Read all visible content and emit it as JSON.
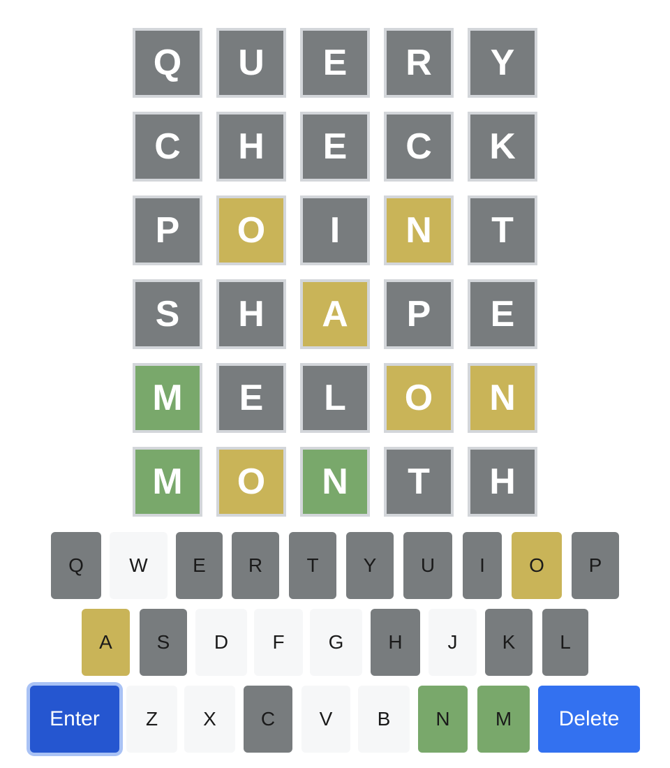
{
  "board": {
    "rows": [
      {
        "letters": [
          "Q",
          "U",
          "E",
          "R",
          "Y"
        ],
        "states": [
          "absent",
          "absent",
          "absent",
          "absent",
          "absent"
        ]
      },
      {
        "letters": [
          "C",
          "H",
          "E",
          "C",
          "K"
        ],
        "states": [
          "absent",
          "absent",
          "absent",
          "absent",
          "absent"
        ]
      },
      {
        "letters": [
          "P",
          "O",
          "I",
          "N",
          "T"
        ],
        "states": [
          "absent",
          "present",
          "absent",
          "present",
          "absent"
        ]
      },
      {
        "letters": [
          "S",
          "H",
          "A",
          "P",
          "E"
        ],
        "states": [
          "absent",
          "absent",
          "present",
          "absent",
          "absent"
        ]
      },
      {
        "letters": [
          "M",
          "E",
          "L",
          "O",
          "N"
        ],
        "states": [
          "correct",
          "absent",
          "absent",
          "present",
          "present"
        ]
      },
      {
        "letters": [
          "M",
          "O",
          "N",
          "T",
          "H"
        ],
        "states": [
          "correct",
          "present",
          "correct",
          "absent",
          "absent"
        ]
      }
    ]
  },
  "keyboard": {
    "rows": [
      [
        {
          "label": "Q",
          "state": "absent"
        },
        {
          "label": "W",
          "state": "unused"
        },
        {
          "label": "E",
          "state": "absent"
        },
        {
          "label": "R",
          "state": "absent"
        },
        {
          "label": "T",
          "state": "absent"
        },
        {
          "label": "Y",
          "state": "absent"
        },
        {
          "label": "U",
          "state": "absent"
        },
        {
          "label": "I",
          "state": "absent"
        },
        {
          "label": "O",
          "state": "present"
        },
        {
          "label": "P",
          "state": "absent"
        }
      ],
      [
        {
          "label": "A",
          "state": "present"
        },
        {
          "label": "S",
          "state": "absent"
        },
        {
          "label": "D",
          "state": "unused"
        },
        {
          "label": "F",
          "state": "unused"
        },
        {
          "label": "G",
          "state": "unused"
        },
        {
          "label": "H",
          "state": "absent"
        },
        {
          "label": "J",
          "state": "unused"
        },
        {
          "label": "K",
          "state": "absent"
        },
        {
          "label": "L",
          "state": "absent"
        }
      ],
      [
        {
          "label": "Enter",
          "state": "enter"
        },
        {
          "label": "Z",
          "state": "unused"
        },
        {
          "label": "X",
          "state": "unused"
        },
        {
          "label": "C",
          "state": "absent"
        },
        {
          "label": "V",
          "state": "unused"
        },
        {
          "label": "B",
          "state": "unused"
        },
        {
          "label": "N",
          "state": "correct"
        },
        {
          "label": "M",
          "state": "correct"
        },
        {
          "label": "Delete",
          "state": "delete"
        }
      ]
    ]
  },
  "colors": {
    "absent": "#787c7e",
    "present": "#c9b458",
    "correct": "#79a86b",
    "unused": "#f6f7f8",
    "enter": "#2556d0",
    "delete": "#3371f0",
    "tile_border": "#d3d6da"
  }
}
